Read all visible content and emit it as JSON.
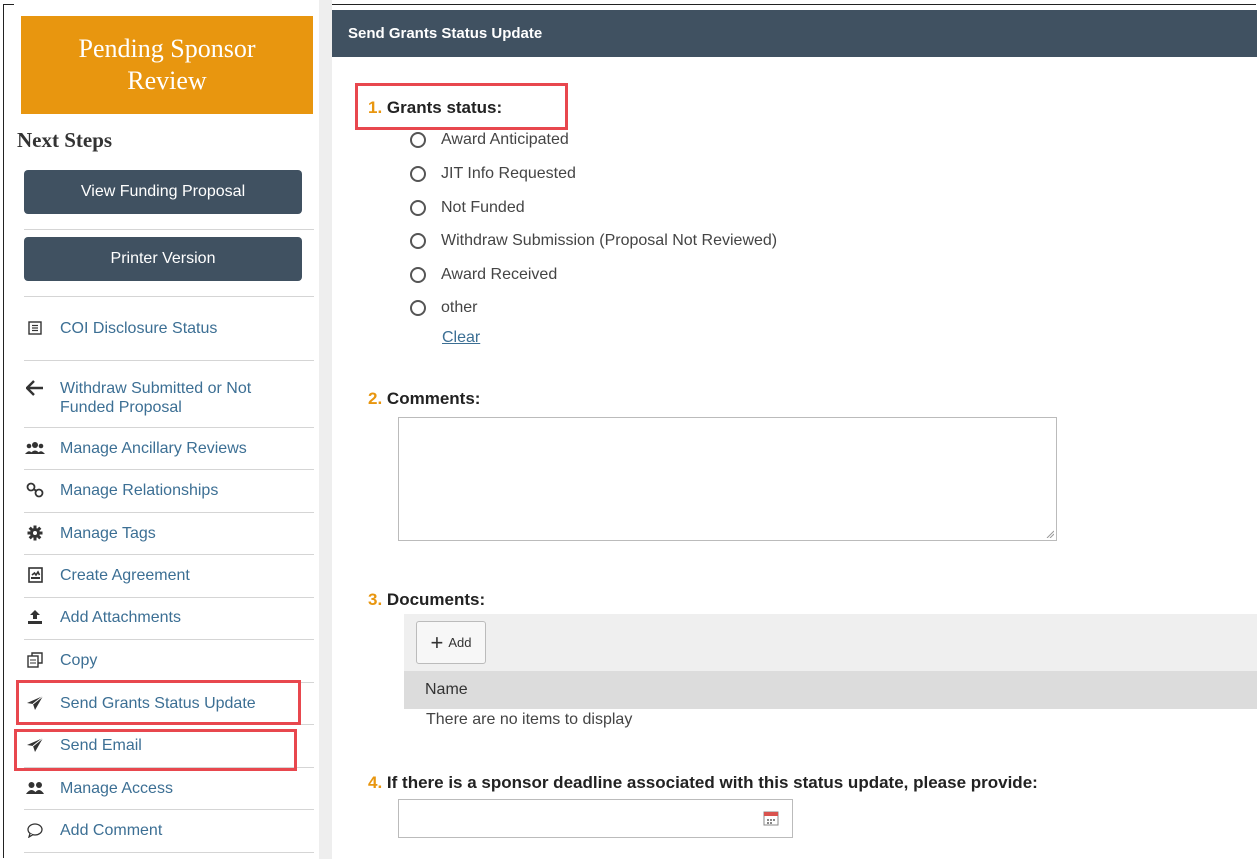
{
  "sidebar": {
    "state": "Pending Sponsor Review",
    "next_steps_title": "Next Steps",
    "buttons": [
      "View Funding Proposal",
      "Printer Version"
    ],
    "items": [
      {
        "label": "COI Disclosure Status",
        "icon": "list-icon"
      },
      {
        "label": "Withdraw Submitted or Not Funded Proposal",
        "icon": "arrow-left-icon"
      },
      {
        "label": "Manage Ancillary Reviews",
        "icon": "users-icon"
      },
      {
        "label": "Manage Relationships",
        "icon": "link-icon"
      },
      {
        "label": "Manage Tags",
        "icon": "gear-icon"
      },
      {
        "label": "Create Agreement",
        "icon": "agreement-icon"
      },
      {
        "label": "Add Attachments",
        "icon": "upload-icon"
      },
      {
        "label": "Copy",
        "icon": "copy-icon"
      },
      {
        "label": "Send Grants Status Update",
        "icon": "send-icon"
      },
      {
        "label": "Send Email",
        "icon": "send-icon"
      },
      {
        "label": "Manage Access",
        "icon": "people-icon"
      },
      {
        "label": "Add Comment",
        "icon": "comment-icon"
      }
    ]
  },
  "form": {
    "title": "Send Grants Status Update",
    "q1": {
      "num": "1.",
      "label": "Grants status:"
    },
    "options": [
      "Award Anticipated",
      "JIT Info Requested",
      "Not Funded",
      "Withdraw Submission (Proposal Not Reviewed)",
      "Award Received",
      "other"
    ],
    "clear": "Clear",
    "q2": {
      "num": "2.",
      "label": "Comments:"
    },
    "comments_value": "",
    "q3": {
      "num": "3.",
      "label": "Documents:"
    },
    "add_label": "Add",
    "column_name": "Name",
    "empty_text": "There are no items to display",
    "q4": {
      "num": "4.",
      "label": "If there is a sponsor deadline associated with this status update, please provide:"
    },
    "deadline_value": ""
  },
  "colors": {
    "accent": "#e8960f",
    "header": "#405161",
    "highlight": "#e8474e",
    "link": "#3c6f94"
  }
}
